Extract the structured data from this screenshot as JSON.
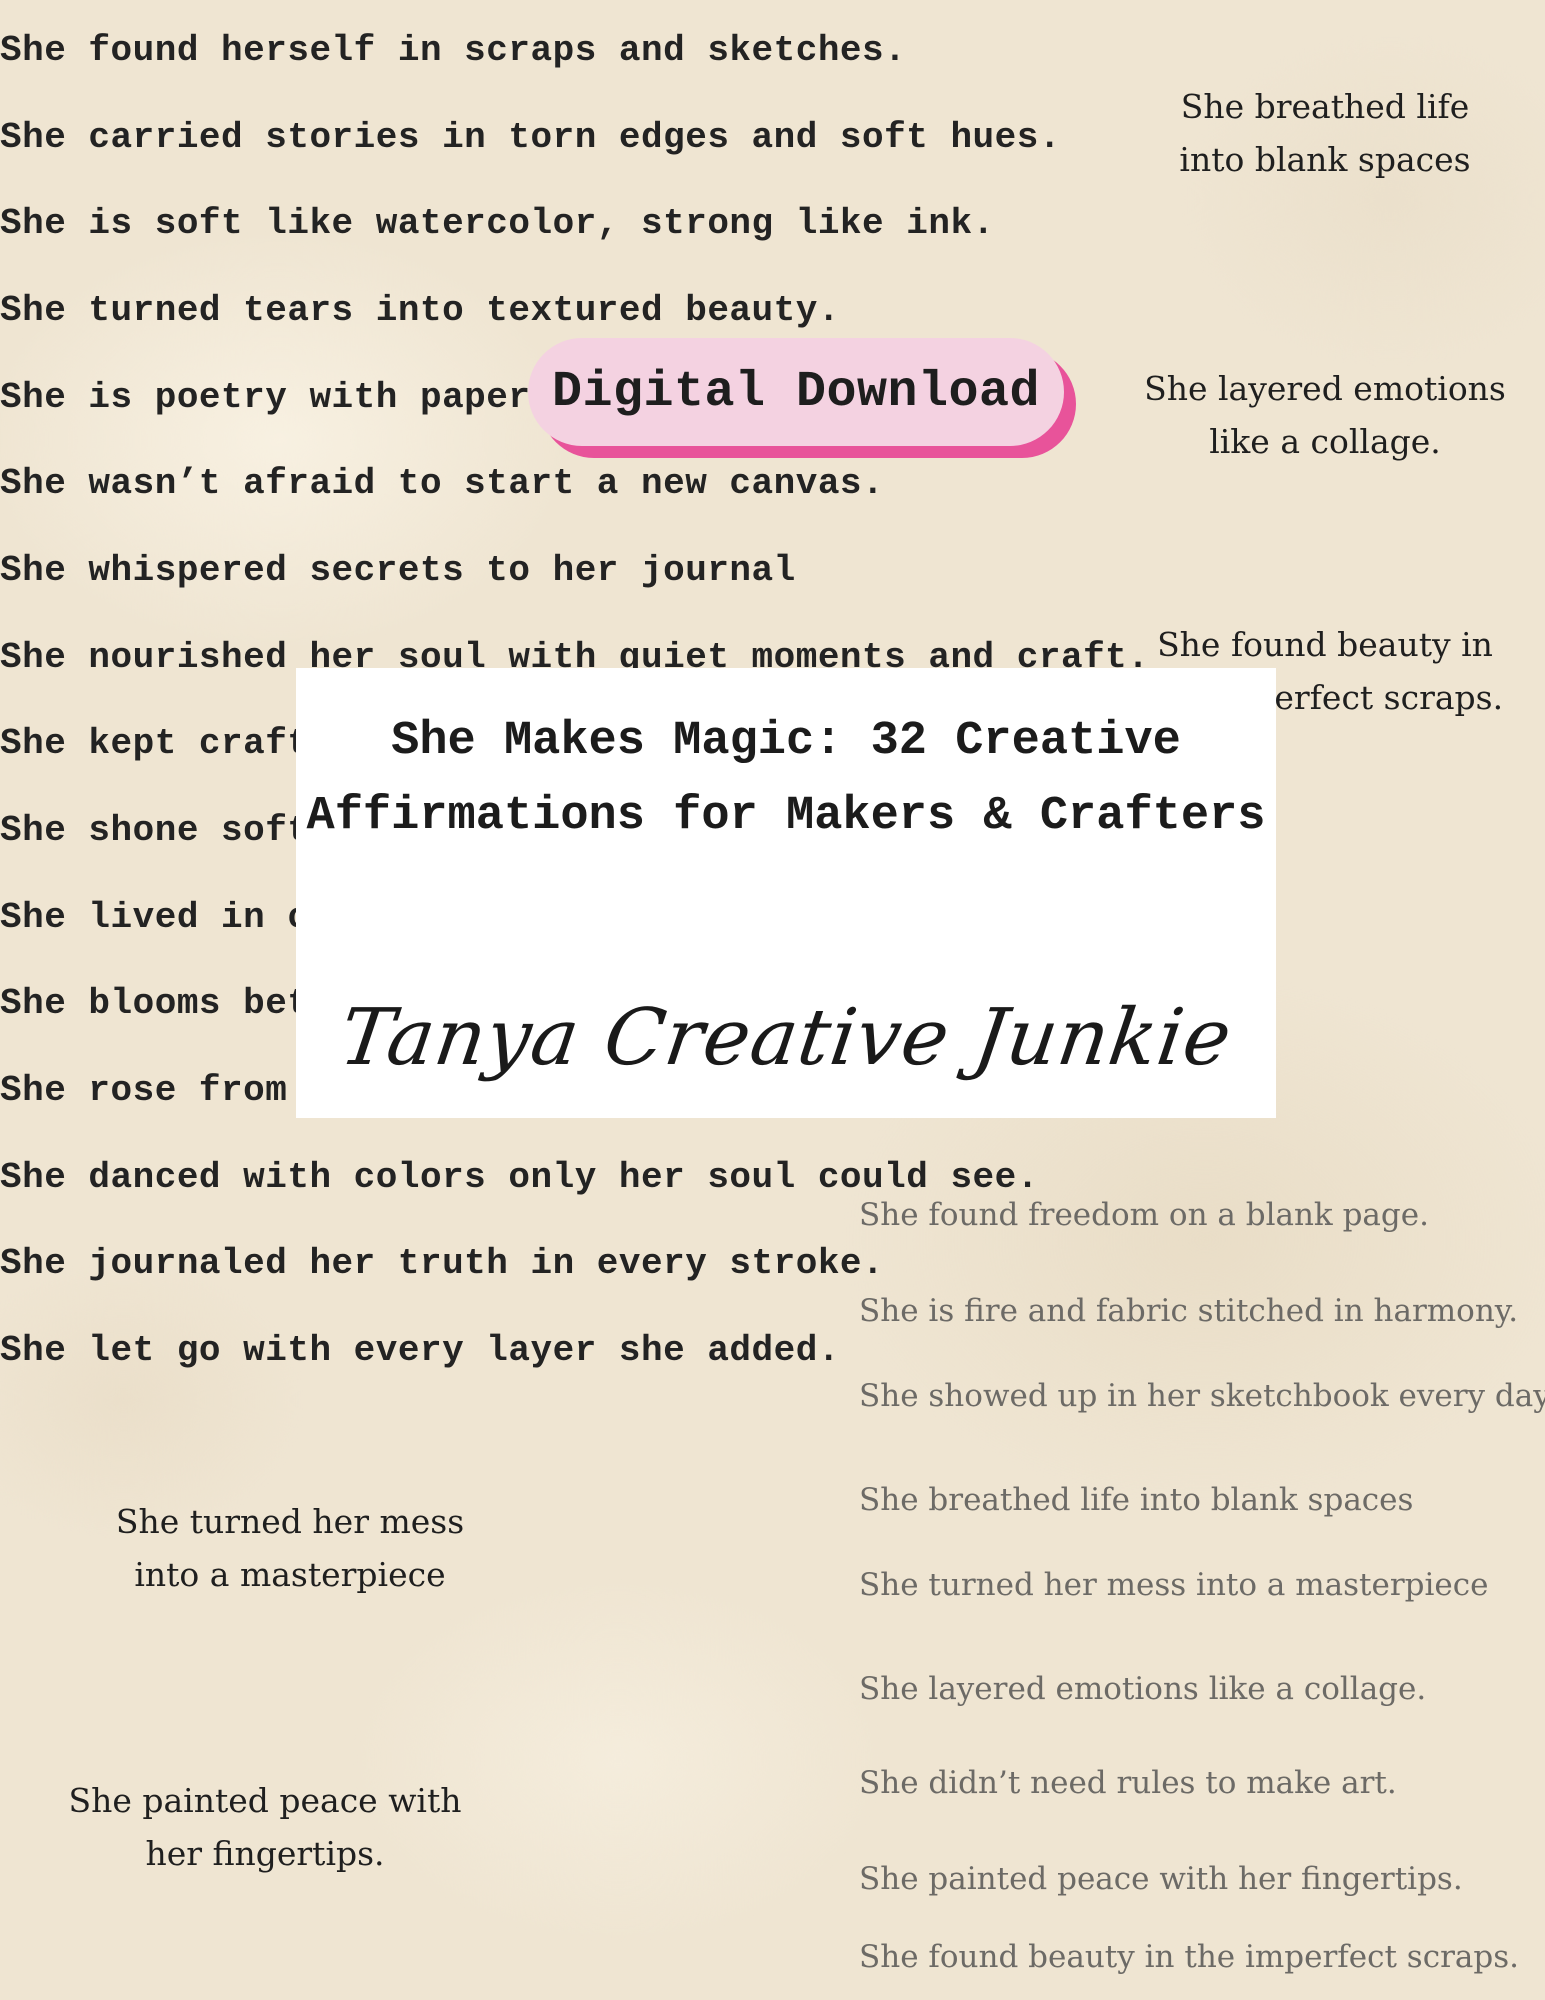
{
  "left_affirmations": [
    "She found herself in scraps and sketches.",
    "She carried stories in torn edges and soft hues.",
    "She is soft like watercolor, strong like ink.",
    "She turned tears into textured beauty.",
    "She is poetry with paper wings.",
    "She wasn’t afraid to start a new canvas.",
    "She whispered secrets to her journal",
    "She nourished her soul with quiet moments and craft.",
    "She kept crafting her dreams.",
    "She shone softly.",
    "She lived in color.",
    "She blooms better.",
    "She rose from the scraps.",
    "She danced with colors only her soul could see.",
    "She journaled her truth in every stroke.",
    "She let go with every layer she added."
  ],
  "side_quotes": [
    {
      "lines": [
        "She breathed life",
        "into blank spaces"
      ]
    },
    {
      "lines": [
        "She layered emotions",
        "like a collage."
      ]
    },
    {
      "lines": [
        "She found beauty in",
        "the imperfect scraps."
      ]
    },
    {
      "lines": [
        "She turned her mess",
        "into a masterpiece"
      ]
    },
    {
      "lines": [
        "She painted peace with",
        "her fingertips."
      ]
    }
  ],
  "faded_affirmations": [
    "She found freedom on a blank page.",
    "She is fire and fabric stitched in harmony.",
    "She showed up in her sketchbook every day.",
    "She breathed life into blank spaces",
    "She turned her mess into a masterpiece",
    "She layered emotions like a collage.",
    "She didn’t need rules to make art.",
    "She painted peace with her fingertips.",
    "She found beauty in the imperfect scraps."
  ],
  "badge": {
    "label": "Digital Download",
    "face_color": "#f4d2e1",
    "shadow_color": "#e8539a"
  },
  "title_card": {
    "title": "She Makes Magic: 32 Creative Affirmations for Makers & Crafters",
    "signature": "Tanya Creative Junkie"
  }
}
